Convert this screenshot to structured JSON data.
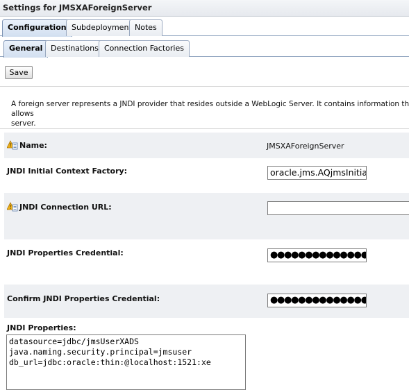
{
  "window": {
    "title": "Settings for JMSXAForeignServer"
  },
  "tabs_primary": [
    {
      "label": "Configuration",
      "active": true
    },
    {
      "label": "Subdeployment",
      "active": false
    },
    {
      "label": "Notes",
      "active": false
    }
  ],
  "tabs_secondary": [
    {
      "label": "General",
      "active": true
    },
    {
      "label": "Destinations",
      "active": false
    },
    {
      "label": "Connection Factories",
      "active": false
    }
  ],
  "toolbar": {
    "save_label": "Save"
  },
  "description": {
    "line1": "A foreign server represents a JNDI provider that resides outside a WebLogic Server. It contains information that allows",
    "line2": "server."
  },
  "form": {
    "name": {
      "label": "Name:",
      "value": "JMSXAForeignServer"
    },
    "context_factory": {
      "label": "JNDI Initial Context Factory:",
      "value": "oracle.jms.AQjmsInitial"
    },
    "connection_url": {
      "label": "JNDI Connection URL:",
      "value": ""
    },
    "credential": {
      "label": "JNDI Properties Credential:",
      "masked": "●●●●●●●●●●●●●●●●●●"
    },
    "confirm_credential": {
      "label": "Confirm JNDI Properties Credential:",
      "masked": "●●●●●●●●●●●●●●●●●●"
    },
    "properties": {
      "label": "JNDI Properties:",
      "lines": [
        "datasource=jdbc/jmsUserXADS",
        "java.naming.security.principal=jmsuser",
        "db_url=jdbc:oracle:thin:@localhost:1521:xe"
      ]
    }
  },
  "icons": {
    "field_help": "config-change-icon"
  },
  "colors": {
    "row_shade": "#eef0f3",
    "tab_active": "#d2dff0",
    "tab_border": "#8fa3bf"
  }
}
